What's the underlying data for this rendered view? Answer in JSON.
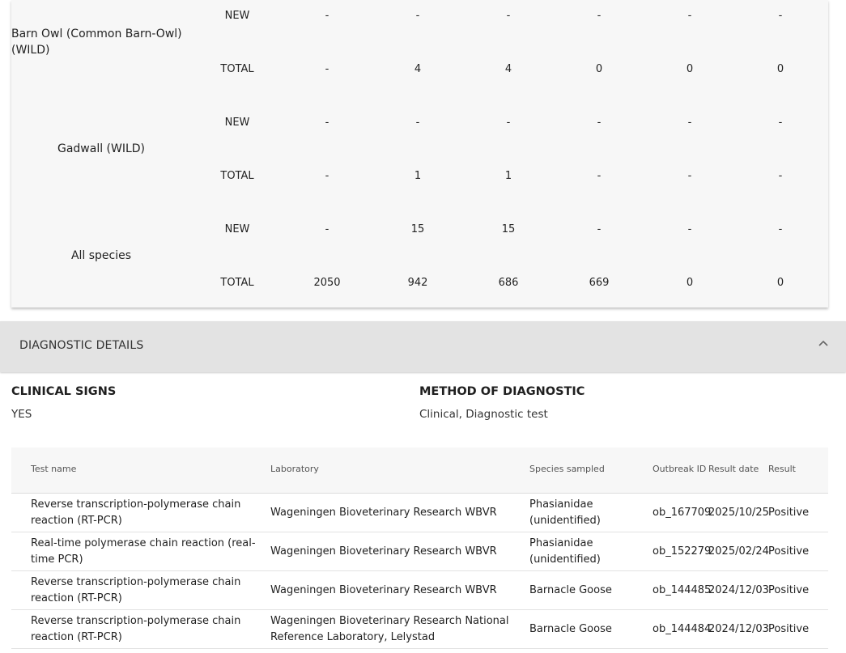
{
  "species_table": {
    "rows": [
      {
        "species": "Barn Owl (Common Barn-Owl) (WILD)",
        "new": [
          "-",
          "-",
          "-",
          "-",
          "-",
          "-"
        ],
        "total": [
          "-",
          "4",
          "4",
          "0",
          "0",
          "0"
        ]
      },
      {
        "species": "Gadwall (WILD)",
        "new": [
          "-",
          "-",
          "-",
          "-",
          "-",
          "-"
        ],
        "total": [
          "-",
          "1",
          "1",
          "-",
          "-",
          "-"
        ]
      },
      {
        "species": "All species",
        "new": [
          "-",
          "15",
          "15",
          "-",
          "-",
          "-"
        ],
        "total": [
          "2050",
          "942",
          "686",
          "669",
          "0",
          "0"
        ]
      }
    ],
    "new_label": "NEW",
    "total_label": "TOTAL"
  },
  "diagnostic": {
    "section_title": "DIAGNOSTIC DETAILS",
    "clinical_signs_label": "CLINICAL SIGNS",
    "clinical_signs_value": "YES",
    "method_label": "METHOD OF DIAGNOSTIC",
    "method_value": "Clinical, Diagnostic test"
  },
  "tests_table": {
    "headers": {
      "test_name": "Test name",
      "laboratory": "Laboratory",
      "species_sampled": "Species sampled",
      "outbreak_id": "Outbreak ID",
      "result_date": "Result date",
      "result": "Result"
    },
    "rows": [
      {
        "test_name": "Reverse transcription-polymerase chain reaction (RT-PCR)",
        "laboratory": "Wageningen Bioveterinary Research WBVR",
        "species_sampled": "Phasianidae (unidentified)",
        "outbreak_id": "ob_167709",
        "result_date": "2025/10/25",
        "result": "Positive"
      },
      {
        "test_name": "Real-time polymerase chain reaction (real-time PCR)",
        "laboratory": "Wageningen Bioveterinary Research WBVR",
        "species_sampled": "Phasianidae (unidentified)",
        "outbreak_id": "ob_152279",
        "result_date": "2025/02/24",
        "result": "Positive"
      },
      {
        "test_name": "Reverse transcription-polymerase chain reaction (RT-PCR)",
        "laboratory": "Wageningen Bioveterinary Research WBVR",
        "species_sampled": "Barnacle Goose",
        "outbreak_id": "ob_144485",
        "result_date": "2024/12/03",
        "result": "Positive"
      },
      {
        "test_name": "Reverse transcription-polymerase chain reaction (RT-PCR)",
        "laboratory": "Wageningen Bioveterinary Research National Reference Laboratory, Lelystad",
        "species_sampled": "Barnacle Goose",
        "outbreak_id": "ob_144484",
        "result_date": "2024/12/03",
        "result": "Positive"
      }
    ]
  }
}
